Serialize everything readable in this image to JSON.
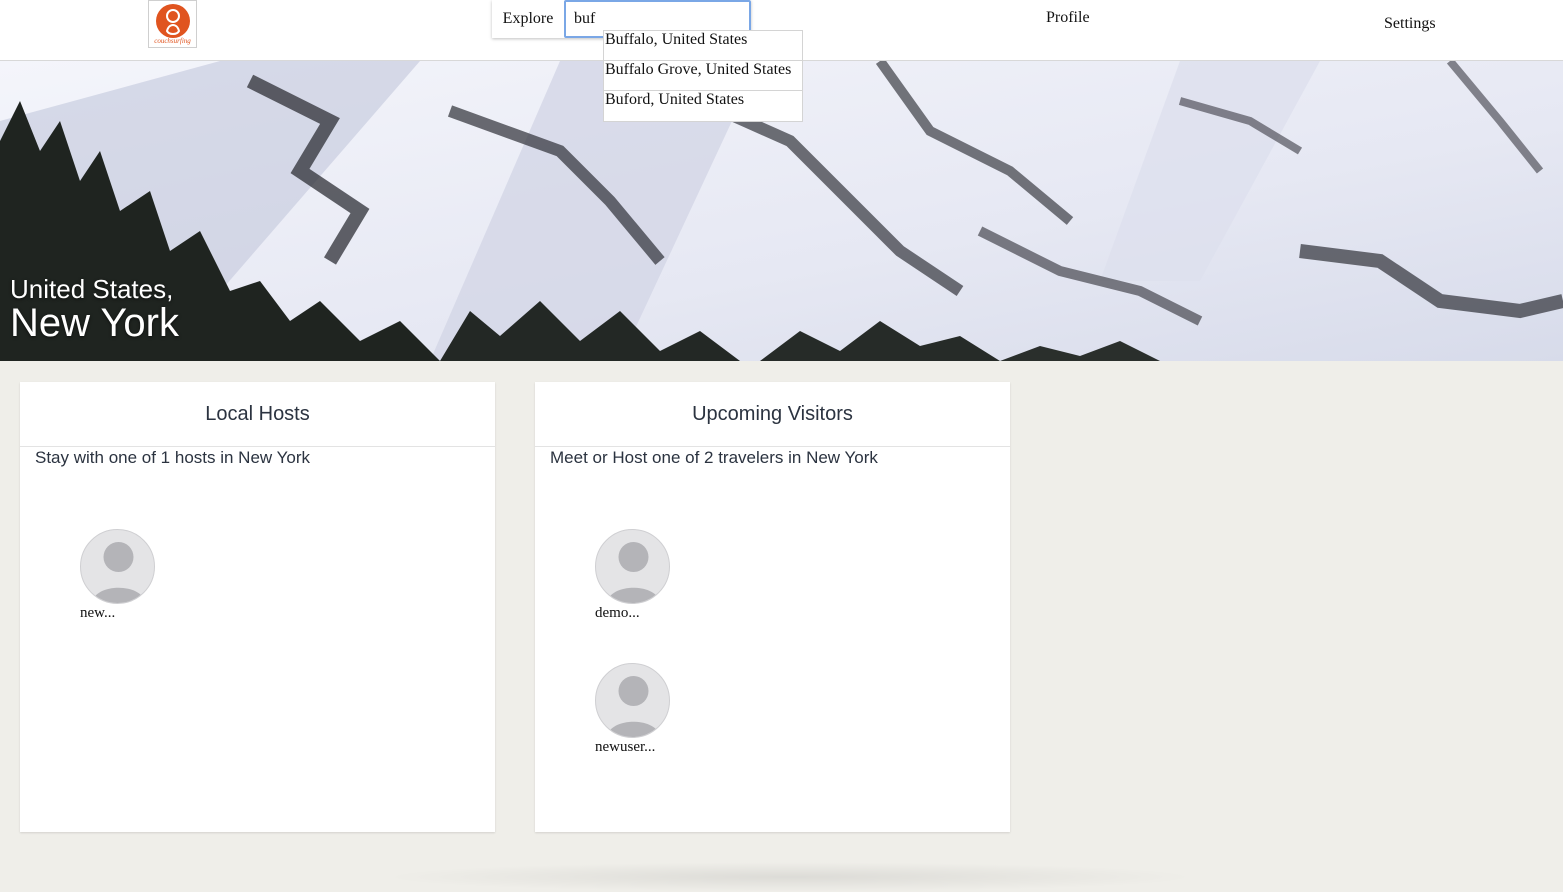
{
  "nav": {
    "logo_text": "couchsurfing",
    "explore_label": "Explore",
    "search_value": "buf",
    "profile_label": "Profile",
    "settings_label": "Settings"
  },
  "suggestions": [
    "Buffalo, United States",
    "Buffalo Grove, United States",
    "Buford, United States"
  ],
  "hero": {
    "country": "United States,",
    "city": "New York"
  },
  "local_hosts": {
    "title": "Local Hosts",
    "subtitle": "Stay with one of 1 hosts in New York",
    "people": [
      {
        "name": "new..."
      }
    ]
  },
  "upcoming_visitors": {
    "title": "Upcoming Visitors",
    "subtitle": "Meet or Host one of 2 travelers in New York",
    "people": [
      {
        "name": "demo..."
      },
      {
        "name": "newuser..."
      }
    ]
  },
  "colors": {
    "brand": "#e0541f",
    "page_bg": "#efeee9",
    "card_title": "#2b3340",
    "focus": "#7aa7e6"
  }
}
